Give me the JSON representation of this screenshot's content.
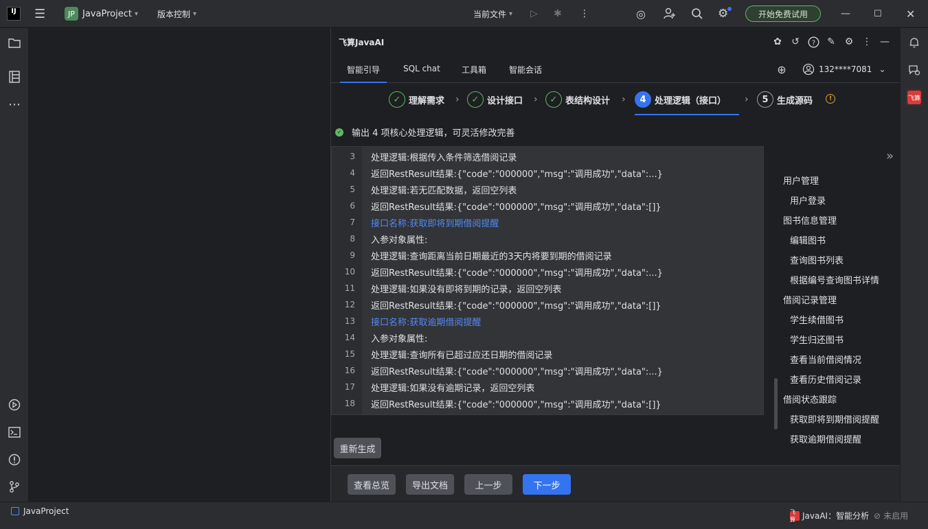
{
  "titlebar": {
    "project_badge": "JP",
    "project_name": "JavaProject",
    "vcs": "版本控制",
    "run_config": "当前文件",
    "trial_button": "开始免费试用"
  },
  "panel": {
    "title": "飞算JavaAI",
    "tabs": [
      {
        "label": "智能引导"
      },
      {
        "label": "SQL chat"
      },
      {
        "label": "工具箱"
      },
      {
        "label": "智能会话"
      }
    ],
    "user": "132****7081",
    "steps": [
      {
        "num": "✓",
        "label": "理解需求"
      },
      {
        "num": "✓",
        "label": "设计接口"
      },
      {
        "num": "✓",
        "label": "表结构设计"
      },
      {
        "num": "4",
        "label": "处理逻辑（接口）"
      },
      {
        "num": "5",
        "label": "生成源码"
      }
    ],
    "status_text": "输出 4 项核心处理逻辑，可灵活修改完善",
    "code_lines": [
      {
        "n": "3",
        "text": "处理逻辑:根据传入条件筛选借阅记录"
      },
      {
        "n": "4",
        "text": "返回RestResult结果:{\"code\":\"000000\",\"msg\":\"调用成功\",\"data\":...}"
      },
      {
        "n": "5",
        "text": "处理逻辑:若无匹配数据，返回空列表"
      },
      {
        "n": "6",
        "text": "返回RestResult结果:{\"code\":\"000000\",\"msg\":\"调用成功\",\"data\":[]}"
      },
      {
        "n": "7",
        "text": "接口名称:获取即将到期借阅提醒"
      },
      {
        "n": "8",
        "text": "入参对象属性:"
      },
      {
        "n": "9",
        "text": "处理逻辑:查询距离当前日期最近的3天内将要到期的借阅记录"
      },
      {
        "n": "10",
        "text": "返回RestResult结果:{\"code\":\"000000\",\"msg\":\"调用成功\",\"data\":...}"
      },
      {
        "n": "11",
        "text": "处理逻辑:如果没有即将到期的记录，返回空列表"
      },
      {
        "n": "12",
        "text": "返回RestResult结果:{\"code\":\"000000\",\"msg\":\"调用成功\",\"data\":[]}"
      },
      {
        "n": "13",
        "text": "接口名称:获取逾期借阅提醒"
      },
      {
        "n": "14",
        "text": "入参对象属性:"
      },
      {
        "n": "15",
        "text": "处理逻辑:查询所有已超过应还日期的借阅记录"
      },
      {
        "n": "16",
        "text": "返回RestResult结果:{\"code\":\"000000\",\"msg\":\"调用成功\",\"data\":...}"
      },
      {
        "n": "17",
        "text": "处理逻辑:如果没有逾期记录，返回空列表"
      },
      {
        "n": "18",
        "text": "返回RestResult结果:{\"code\":\"000000\",\"msg\":\"调用成功\",\"data\":[]}"
      }
    ],
    "regen_button": "重新生成",
    "buttons": {
      "overview": "查看总览",
      "export": "导出文档",
      "prev": "上一步",
      "next": "下一步"
    },
    "outline": [
      {
        "text": "用户管理",
        "level": 0
      },
      {
        "text": "用户登录",
        "level": 1
      },
      {
        "text": "图书信息管理",
        "level": 0
      },
      {
        "text": "编辑图书",
        "level": 1
      },
      {
        "text": "查询图书列表",
        "level": 1
      },
      {
        "text": "根据编号查询图书详情",
        "level": 1
      },
      {
        "text": "借阅记录管理",
        "level": 0
      },
      {
        "text": "学生续借图书",
        "level": 1
      },
      {
        "text": "学生归还图书",
        "level": 1
      },
      {
        "text": "查看当前借阅情况",
        "level": 1
      },
      {
        "text": "查看历史借阅记录",
        "level": 1
      },
      {
        "text": "借阅状态跟踪",
        "level": 0
      },
      {
        "text": "获取即将到期借阅提醒",
        "level": 1
      },
      {
        "text": "获取逾期借阅提醒",
        "level": 1
      }
    ]
  },
  "right_tool": {
    "label": "飞算"
  },
  "statusbar": {
    "project": "JavaProject",
    "plugin_logo": "飞算",
    "plugin": "JavaAI：智能分析",
    "state": "未启用"
  },
  "colors": {
    "accent": "#3574f0",
    "success": "#5fb865",
    "link": "#548af7"
  }
}
